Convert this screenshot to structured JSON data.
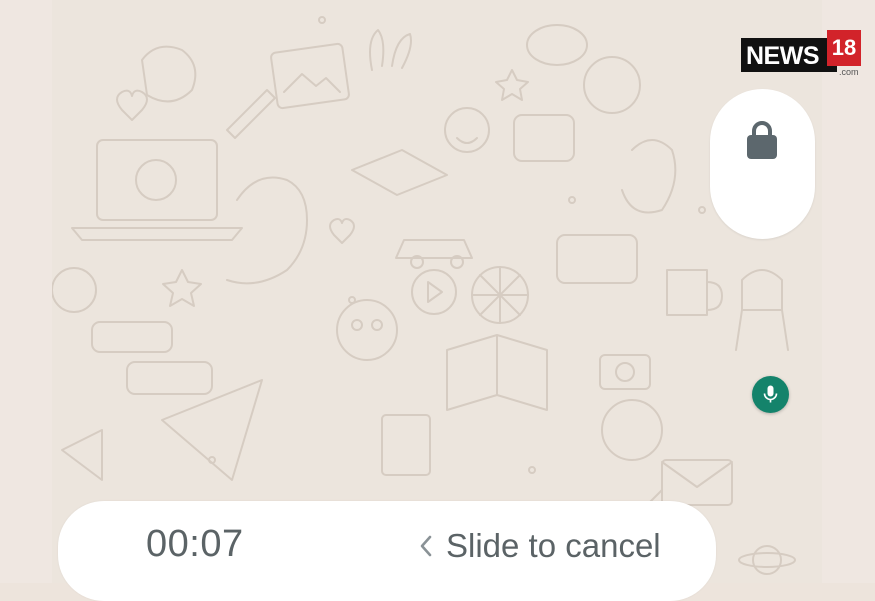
{
  "brand": {
    "news_label": "NEWS",
    "number_label": "18",
    "domain_suffix": ".com"
  },
  "recorder": {
    "elapsed_time": "00:07",
    "slide_hint": "Slide to cancel"
  },
  "icons": {
    "lock": "lock-icon",
    "mic": "mic-icon",
    "chevron": "chevron-left-icon"
  },
  "colors": {
    "wallpaper": "#ece5dd",
    "mic_button": "#14836b",
    "lock_icon": "#5c676d",
    "text_gray": "#5b6366",
    "logo_red": "#d2232a"
  }
}
